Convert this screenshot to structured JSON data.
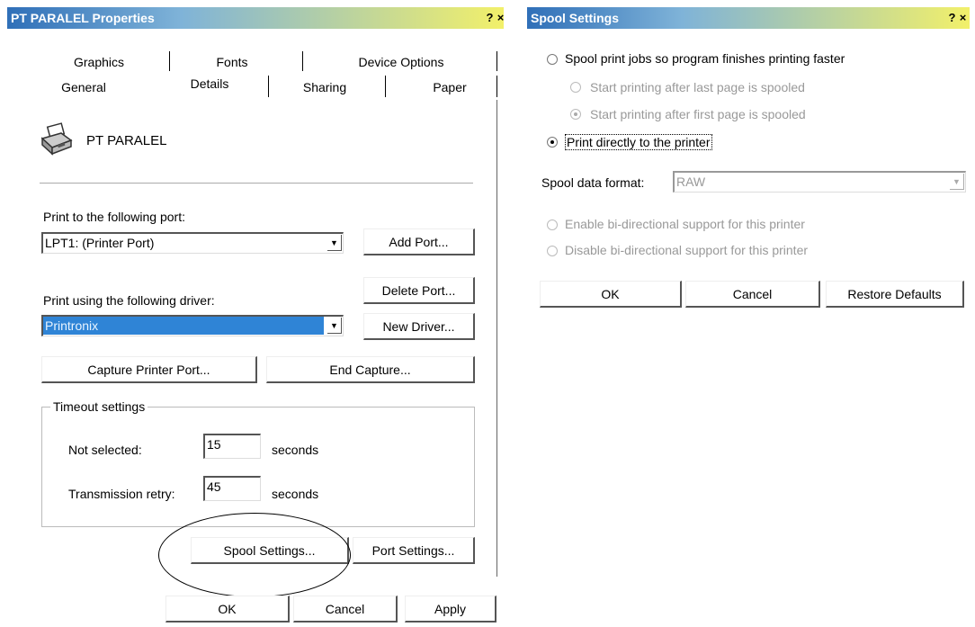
{
  "properties": {
    "title": "PT PARALEL Properties",
    "help": "?",
    "close": "×",
    "tabs_row1": [
      "Graphics",
      "Fonts",
      "Device Options"
    ],
    "tabs_row2": [
      "General",
      "Details",
      "Sharing",
      "Paper"
    ],
    "active_tab": "Details",
    "printer_name": "PT PARALEL",
    "port_label": "Print to the following port:",
    "port_value": "LPT1:  (Printer Port)",
    "add_port": "Add Port...",
    "delete_port": "Delete Port...",
    "driver_label": "Print using the following driver:",
    "driver_value": "Printronix",
    "new_driver": "New Driver...",
    "capture_port": "Capture Printer Port...",
    "end_capture": "End Capture...",
    "timeout_group": "Timeout settings",
    "not_selected_label": "Not selected:",
    "not_selected_value": "15",
    "not_selected_unit": "seconds",
    "retry_label": "Transmission retry:",
    "retry_value": "45",
    "retry_unit": "seconds",
    "spool_settings": "Spool Settings...",
    "port_settings": "Port Settings...",
    "ok": "OK",
    "cancel": "Cancel",
    "apply": "Apply"
  },
  "spool": {
    "title": "Spool Settings",
    "help": "?",
    "close": "×",
    "opt_spool": "Spool print jobs so program finishes printing faster",
    "opt_after_last": "Start printing after last page is spooled",
    "opt_after_first": "Start printing after first page is spooled",
    "opt_direct": "Print directly to the printer",
    "format_label": "Spool data format:",
    "format_value": "RAW",
    "opt_enable_bidi": "Enable bi-directional support for this printer",
    "opt_disable_bidi": "Disable bi-directional support for this printer",
    "ok": "OK",
    "cancel": "Cancel",
    "restore": "Restore Defaults",
    "selected_spool_mode": "Print directly to the printer"
  },
  "colors": {
    "title_gradient_start": "#2f6fb8",
    "title_gradient_end": "#f2f06a",
    "selection_bg": "#2f84d6"
  }
}
